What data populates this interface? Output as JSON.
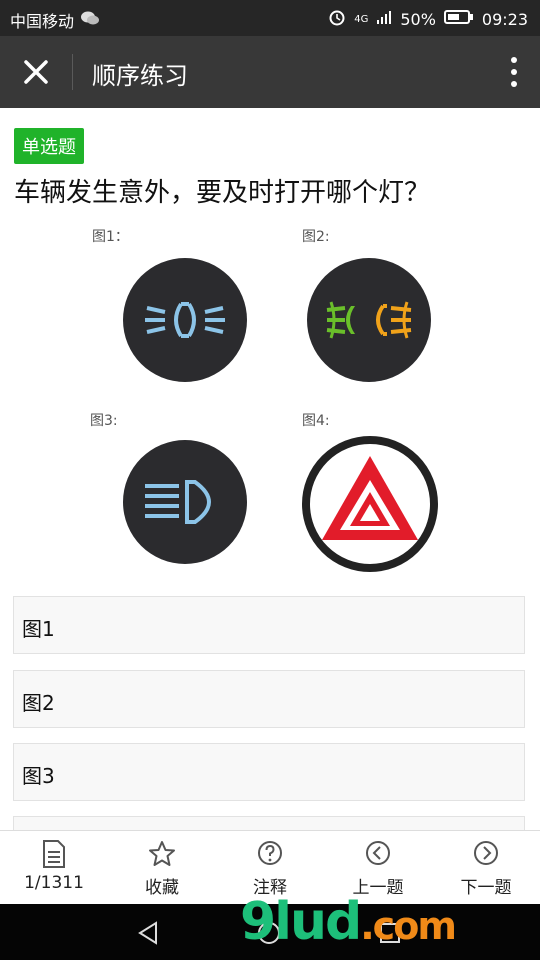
{
  "status_bar": {
    "carrier": "中国移动",
    "network": "4G",
    "battery": "50%",
    "time": "09:23"
  },
  "title_bar": {
    "title": "顺序练习",
    "close_icon": "close-icon",
    "more_icon": "more-vertical-icon"
  },
  "question": {
    "type_badge": "单选题",
    "text": "车辆发生意外，要及时打开哪个灯？",
    "figure_labels": [
      "图1：",
      "图2:",
      "图3:",
      "图4:"
    ]
  },
  "options": [
    "图1",
    "图2",
    "图3"
  ],
  "bottom_nav": {
    "progress": "1/1311",
    "favorite": "收藏",
    "explain": "注释",
    "prev": "上一题",
    "next": "下一题"
  },
  "watermark": {
    "text": "9lud",
    "suffix": ".com"
  },
  "colors": {
    "badge_green": "#20b32a",
    "title_bar": "#383838",
    "hazard_red": "#e21c2a"
  }
}
